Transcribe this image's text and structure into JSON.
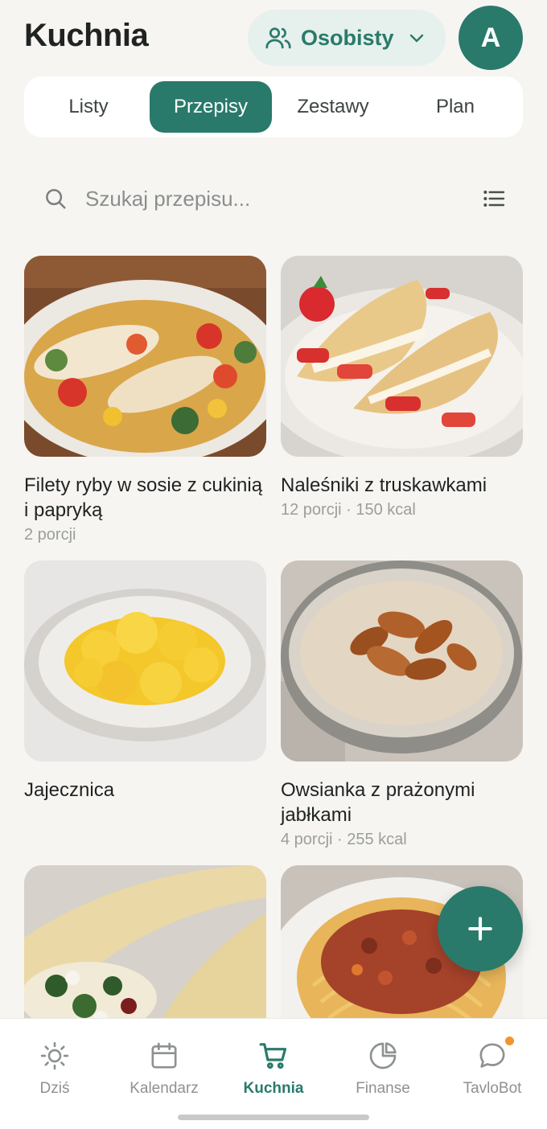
{
  "header": {
    "title": "Kuchnia",
    "profile_switch_label": "Osobisty",
    "avatar_initial": "A"
  },
  "tabs": [
    {
      "label": "Listy",
      "active": false
    },
    {
      "label": "Przepisy",
      "active": true
    },
    {
      "label": "Zestawy",
      "active": false
    },
    {
      "label": "Plan",
      "active": false
    }
  ],
  "search": {
    "placeholder": "Szukaj przepisu..."
  },
  "recipes": [
    {
      "title": "Filety ryby w sosie z cukinią i papryką",
      "meta": "2 porcji"
    },
    {
      "title": "Naleśniki z truskawkami",
      "meta": "12 porcji · 150 kcal"
    },
    {
      "title": "Jajecznica",
      "meta": ""
    },
    {
      "title": "Owsianka z prażonymi jabłkami",
      "meta": "4 porcji · 255 kcal"
    },
    {
      "title": "",
      "meta": ""
    },
    {
      "title": "",
      "meta": ""
    }
  ],
  "fab": {
    "icon": "plus-icon"
  },
  "bottom_nav": [
    {
      "label": "Dziś",
      "icon": "sun-icon",
      "active": false
    },
    {
      "label": "Kalendarz",
      "icon": "calendar-icon",
      "active": false
    },
    {
      "label": "Kuchnia",
      "icon": "cart-icon",
      "active": true
    },
    {
      "label": "Finanse",
      "icon": "pie-chart-icon",
      "active": false
    },
    {
      "label": "TavloBot",
      "icon": "chat-bubble-icon",
      "active": false,
      "badge": true
    }
  ],
  "colors": {
    "accent": "#2a7a6b",
    "accent_light": "#e6f0ec",
    "background": "#f7f5f2",
    "badge": "#f0962e"
  }
}
